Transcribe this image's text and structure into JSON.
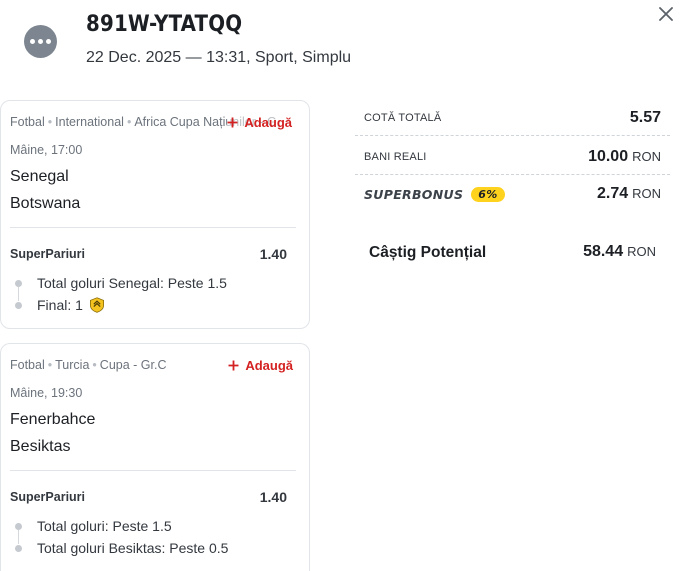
{
  "header": {
    "ticket_code": "891W-YTATQQ",
    "meta": "22 Dec. 2025 — 13:31, Sport, Simplu"
  },
  "events": [
    {
      "sport": "Fotbal",
      "country": "International",
      "competition": "Africa Cupa Națiunilor - G",
      "add_label": "Adaugă",
      "time": "Mâine, 17:00",
      "home": "Senegal",
      "away": "Botswana",
      "market": "SuperPariuri",
      "odd": "1.40",
      "selections": [
        "Total goluri Senegal: Peste 1.5",
        "Final: 1"
      ]
    },
    {
      "sport": "Fotbal",
      "country": "Turcia",
      "competition": "Cupa - Gr.C",
      "add_label": "Adaugă",
      "time": "Mâine, 19:30",
      "home": "Fenerbahce",
      "away": "Besiktas",
      "market": "SuperPariuri",
      "odd": "1.40",
      "selections": [
        "Total goluri: Peste 1.5",
        "Total goluri Besiktas: Peste 0.5"
      ]
    }
  ],
  "summary": {
    "total_odds_label": "COTĂ TOTALĂ",
    "total_odds_value": "5.57",
    "stake_label": "BANI REALI",
    "stake_value": "10.00",
    "currency": "RON",
    "superbonus_label": "SUPERBONUS",
    "superbonus_percent": "6%",
    "superbonus_value": "2.74",
    "potential_label": "Câștig Potențial",
    "potential_value": "58.44"
  },
  "icons": {
    "header": "more-dots-icon",
    "close": "close-icon",
    "add": "plus-icon",
    "boost": "boost-shield-icon"
  },
  "colors": {
    "accent_red": "#d42121",
    "badge_yellow": "#ffd21e",
    "icon_gray": "#7c8590"
  }
}
